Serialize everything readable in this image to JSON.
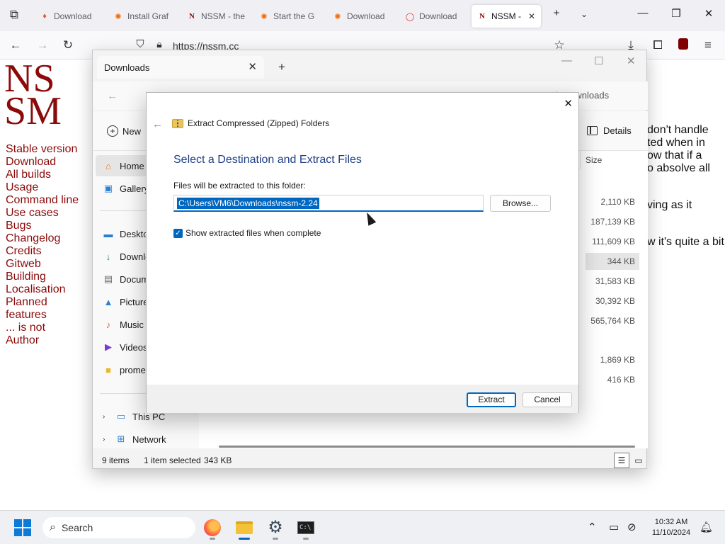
{
  "browser": {
    "tabs": [
      {
        "label": "Download",
        "icon": "flame-icon",
        "icon_color": "#e4572e"
      },
      {
        "label": "Install Graf",
        "icon": "grafana-icon",
        "icon_color": "#f46800"
      },
      {
        "label": "NSSM - the",
        "icon": "nssm-icon",
        "icon_color": "#8b0a0a"
      },
      {
        "label": "Start the G",
        "icon": "grafana-icon",
        "icon_color": "#f46800"
      },
      {
        "label": "Download",
        "icon": "grafana-icon",
        "icon_color": "#f46800"
      },
      {
        "label": "Download",
        "icon": "opera-icon",
        "icon_color": "#e0282e"
      },
      {
        "label": "NSSM -",
        "icon": "nssm-icon",
        "icon_color": "#8b0a0a",
        "active": true
      }
    ],
    "url": "https://nssm.cc"
  },
  "page": {
    "logo_line1": "NS",
    "logo_line2": "SM",
    "nav": [
      "Stable version",
      "Download",
      "All builds",
      "Usage",
      "Command line",
      "Use cases",
      "Bugs",
      "Changelog",
      "Credits",
      "Gitweb",
      "Building",
      "Localisation",
      "Planned",
      "features",
      "... is not",
      "Author"
    ],
    "fragments": [
      "don't handle",
      "ted when in",
      "ow that if a",
      "o absolve all",
      "ving as it",
      "w it's quite a bit"
    ]
  },
  "explorer": {
    "tab_title": "Downloads",
    "search_placeholder": "Search Downloads",
    "new_label": "New",
    "details_label": "Details",
    "sidebar": [
      {
        "label": "Home",
        "icon": "home-icon",
        "selected": true
      },
      {
        "label": "Gallery",
        "icon": "gallery-icon"
      },
      {
        "label": "Desktop",
        "icon": "desktop-icon"
      },
      {
        "label": "Downloads",
        "icon": "download-icon"
      },
      {
        "label": "Documents",
        "icon": "documents-icon"
      },
      {
        "label": "Pictures",
        "icon": "pictures-icon"
      },
      {
        "label": "Music",
        "icon": "music-icon"
      },
      {
        "label": "Videos",
        "icon": "videos-icon"
      },
      {
        "label": "prometheus",
        "icon": "folder-icon"
      }
    ],
    "tree": [
      {
        "label": "This PC",
        "icon": "pc-icon"
      },
      {
        "label": "Network",
        "icon": "network-icon"
      }
    ],
    "column_size": "Size",
    "sizes": [
      "2,110 KB",
      "187,139 KB",
      "111,609 KB",
      "344 KB",
      "31,583 KB",
      "30,392 KB",
      "565,764 KB",
      "",
      "1,869 KB",
      "416 KB"
    ],
    "selected_size_index": 3,
    "status": {
      "items": "9 items",
      "selection": "1 item selected",
      "size": "343 KB"
    }
  },
  "dialog": {
    "header": "Extract Compressed (Zipped) Folders",
    "title": "Select a Destination and Extract Files",
    "folder_label": "Files will be extracted to this folder:",
    "path": "C:\\Users\\VM6\\Downloads\\nssm-2.24",
    "browse_label": "Browse...",
    "show_files_label": "Show extracted files when complete",
    "show_files_checked": true,
    "extract_label": "Extract",
    "cancel_label": "Cancel"
  },
  "taskbar": {
    "search_label": "Search",
    "time": "10:32 AM",
    "date": "11/10/2024"
  }
}
